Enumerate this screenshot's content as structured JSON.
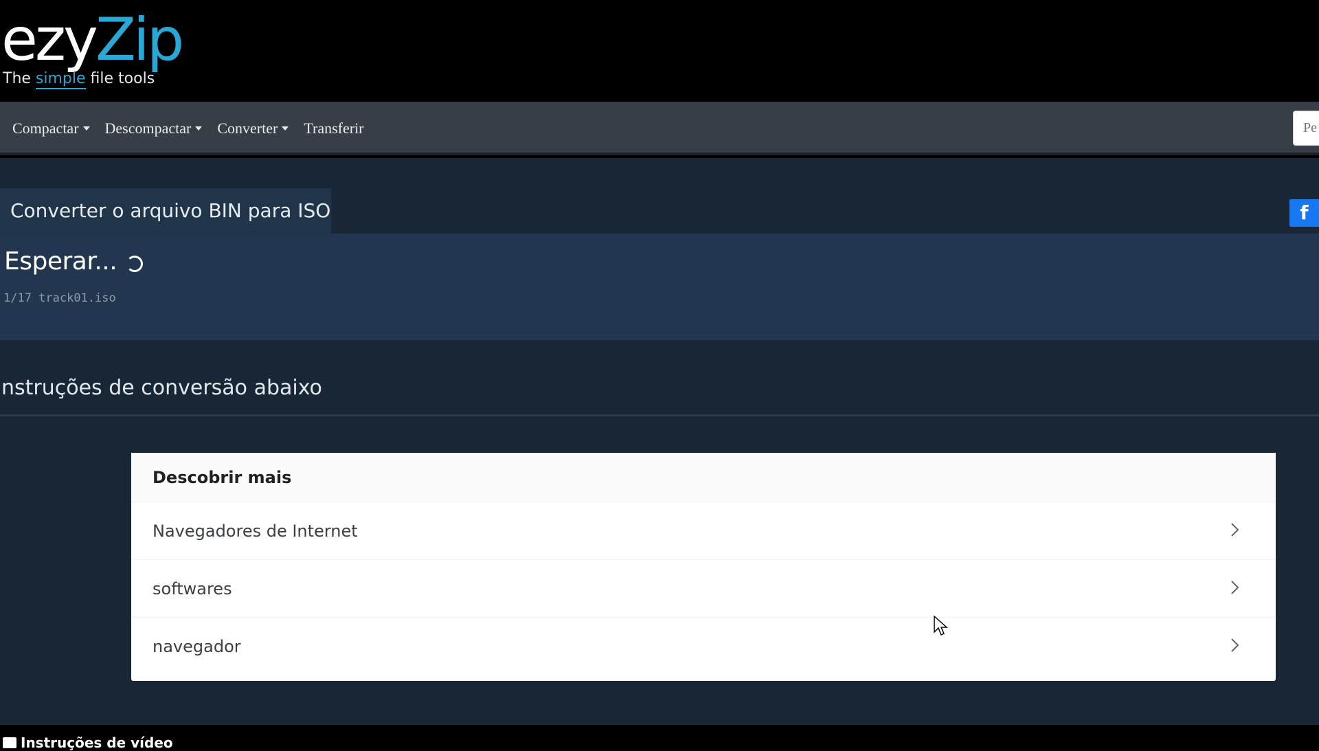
{
  "logo": {
    "brand_prefix": "ezy",
    "brand_suffix": "Zip",
    "tagline_before": "The",
    "tagline_highlight": "simple",
    "tagline_after": "file tools"
  },
  "nav": {
    "items": [
      {
        "label": "Compactar",
        "dropdown": true
      },
      {
        "label": "Descompactar",
        "dropdown": true
      },
      {
        "label": "Converter",
        "dropdown": true
      },
      {
        "label": "Transferir",
        "dropdown": false
      }
    ],
    "search_placeholder": "Pe"
  },
  "main": {
    "title": "Converter o arquivo BIN para ISO",
    "social_label": "f",
    "status": {
      "text": "Esperar...",
      "file": "1/17 track01.iso"
    },
    "instructions_heading": "nstruções de conversão abaixo"
  },
  "discover": {
    "title": "Descobrir mais",
    "items": [
      {
        "label": "Navegadores de Internet"
      },
      {
        "label": "softwares"
      },
      {
        "label": "navegador"
      }
    ]
  },
  "footer": {
    "text": "Instruções de vídeo"
  },
  "colors": {
    "brand_accent": "#29a8d8",
    "navbar_bg": "#373e46",
    "main_bg": "#182636",
    "status_bg": "#223650",
    "facebook": "#1877f2"
  }
}
